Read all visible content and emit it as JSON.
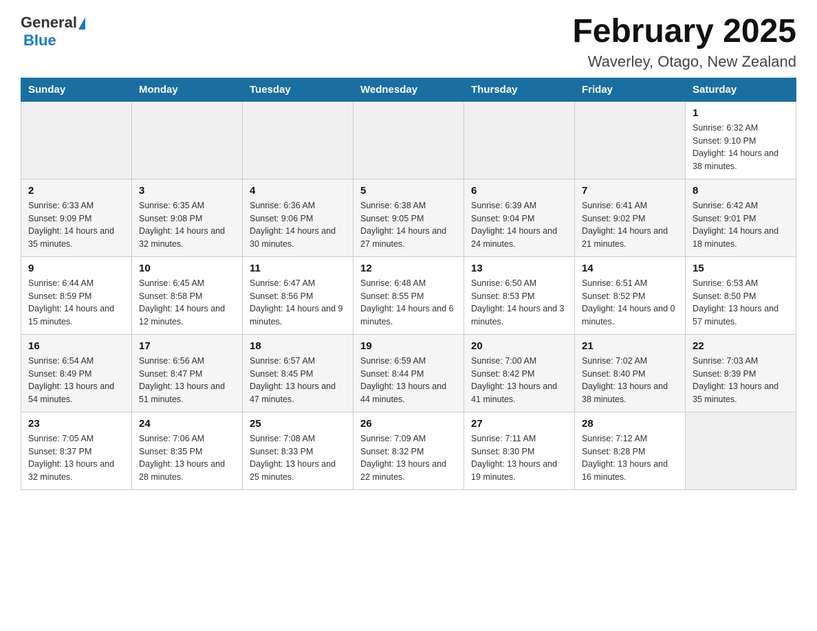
{
  "header": {
    "logo_general": "General",
    "logo_blue": "Blue",
    "month_title": "February 2025",
    "location": "Waverley, Otago, New Zealand"
  },
  "weekdays": [
    "Sunday",
    "Monday",
    "Tuesday",
    "Wednesday",
    "Thursday",
    "Friday",
    "Saturday"
  ],
  "weeks": [
    [
      {
        "day": "",
        "info": ""
      },
      {
        "day": "",
        "info": ""
      },
      {
        "day": "",
        "info": ""
      },
      {
        "day": "",
        "info": ""
      },
      {
        "day": "",
        "info": ""
      },
      {
        "day": "",
        "info": ""
      },
      {
        "day": "1",
        "info": "Sunrise: 6:32 AM\nSunset: 9:10 PM\nDaylight: 14 hours and 38 minutes."
      }
    ],
    [
      {
        "day": "2",
        "info": "Sunrise: 6:33 AM\nSunset: 9:09 PM\nDaylight: 14 hours and 35 minutes."
      },
      {
        "day": "3",
        "info": "Sunrise: 6:35 AM\nSunset: 9:08 PM\nDaylight: 14 hours and 32 minutes."
      },
      {
        "day": "4",
        "info": "Sunrise: 6:36 AM\nSunset: 9:06 PM\nDaylight: 14 hours and 30 minutes."
      },
      {
        "day": "5",
        "info": "Sunrise: 6:38 AM\nSunset: 9:05 PM\nDaylight: 14 hours and 27 minutes."
      },
      {
        "day": "6",
        "info": "Sunrise: 6:39 AM\nSunset: 9:04 PM\nDaylight: 14 hours and 24 minutes."
      },
      {
        "day": "7",
        "info": "Sunrise: 6:41 AM\nSunset: 9:02 PM\nDaylight: 14 hours and 21 minutes."
      },
      {
        "day": "8",
        "info": "Sunrise: 6:42 AM\nSunset: 9:01 PM\nDaylight: 14 hours and 18 minutes."
      }
    ],
    [
      {
        "day": "9",
        "info": "Sunrise: 6:44 AM\nSunset: 8:59 PM\nDaylight: 14 hours and 15 minutes."
      },
      {
        "day": "10",
        "info": "Sunrise: 6:45 AM\nSunset: 8:58 PM\nDaylight: 14 hours and 12 minutes."
      },
      {
        "day": "11",
        "info": "Sunrise: 6:47 AM\nSunset: 8:56 PM\nDaylight: 14 hours and 9 minutes."
      },
      {
        "day": "12",
        "info": "Sunrise: 6:48 AM\nSunset: 8:55 PM\nDaylight: 14 hours and 6 minutes."
      },
      {
        "day": "13",
        "info": "Sunrise: 6:50 AM\nSunset: 8:53 PM\nDaylight: 14 hours and 3 minutes."
      },
      {
        "day": "14",
        "info": "Sunrise: 6:51 AM\nSunset: 8:52 PM\nDaylight: 14 hours and 0 minutes."
      },
      {
        "day": "15",
        "info": "Sunrise: 6:53 AM\nSunset: 8:50 PM\nDaylight: 13 hours and 57 minutes."
      }
    ],
    [
      {
        "day": "16",
        "info": "Sunrise: 6:54 AM\nSunset: 8:49 PM\nDaylight: 13 hours and 54 minutes."
      },
      {
        "day": "17",
        "info": "Sunrise: 6:56 AM\nSunset: 8:47 PM\nDaylight: 13 hours and 51 minutes."
      },
      {
        "day": "18",
        "info": "Sunrise: 6:57 AM\nSunset: 8:45 PM\nDaylight: 13 hours and 47 minutes."
      },
      {
        "day": "19",
        "info": "Sunrise: 6:59 AM\nSunset: 8:44 PM\nDaylight: 13 hours and 44 minutes."
      },
      {
        "day": "20",
        "info": "Sunrise: 7:00 AM\nSunset: 8:42 PM\nDaylight: 13 hours and 41 minutes."
      },
      {
        "day": "21",
        "info": "Sunrise: 7:02 AM\nSunset: 8:40 PM\nDaylight: 13 hours and 38 minutes."
      },
      {
        "day": "22",
        "info": "Sunrise: 7:03 AM\nSunset: 8:39 PM\nDaylight: 13 hours and 35 minutes."
      }
    ],
    [
      {
        "day": "23",
        "info": "Sunrise: 7:05 AM\nSunset: 8:37 PM\nDaylight: 13 hours and 32 minutes."
      },
      {
        "day": "24",
        "info": "Sunrise: 7:06 AM\nSunset: 8:35 PM\nDaylight: 13 hours and 28 minutes."
      },
      {
        "day": "25",
        "info": "Sunrise: 7:08 AM\nSunset: 8:33 PM\nDaylight: 13 hours and 25 minutes."
      },
      {
        "day": "26",
        "info": "Sunrise: 7:09 AM\nSunset: 8:32 PM\nDaylight: 13 hours and 22 minutes."
      },
      {
        "day": "27",
        "info": "Sunrise: 7:11 AM\nSunset: 8:30 PM\nDaylight: 13 hours and 19 minutes."
      },
      {
        "day": "28",
        "info": "Sunrise: 7:12 AM\nSunset: 8:28 PM\nDaylight: 13 hours and 16 minutes."
      },
      {
        "day": "",
        "info": ""
      }
    ]
  ]
}
